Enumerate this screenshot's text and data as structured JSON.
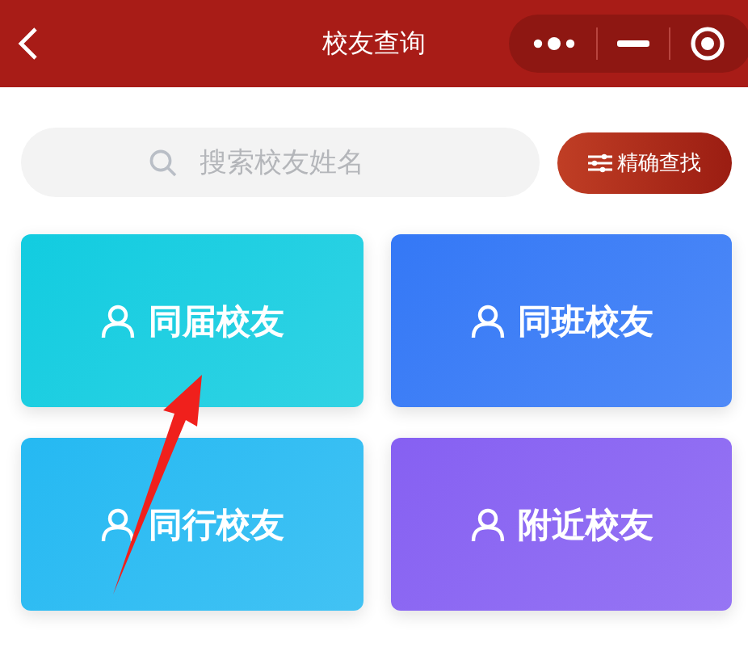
{
  "header": {
    "title": "校友查询"
  },
  "search": {
    "placeholder": "搜索校友姓名",
    "button": "精确查找"
  },
  "cards": [
    {
      "label": "同届校友",
      "color": "#12cce0"
    },
    {
      "label": "同班校友",
      "color": "#3478f6"
    },
    {
      "label": "同行校友",
      "color": "#25b9f2"
    },
    {
      "label": "附近校友",
      "color": "#8660f2"
    }
  ]
}
